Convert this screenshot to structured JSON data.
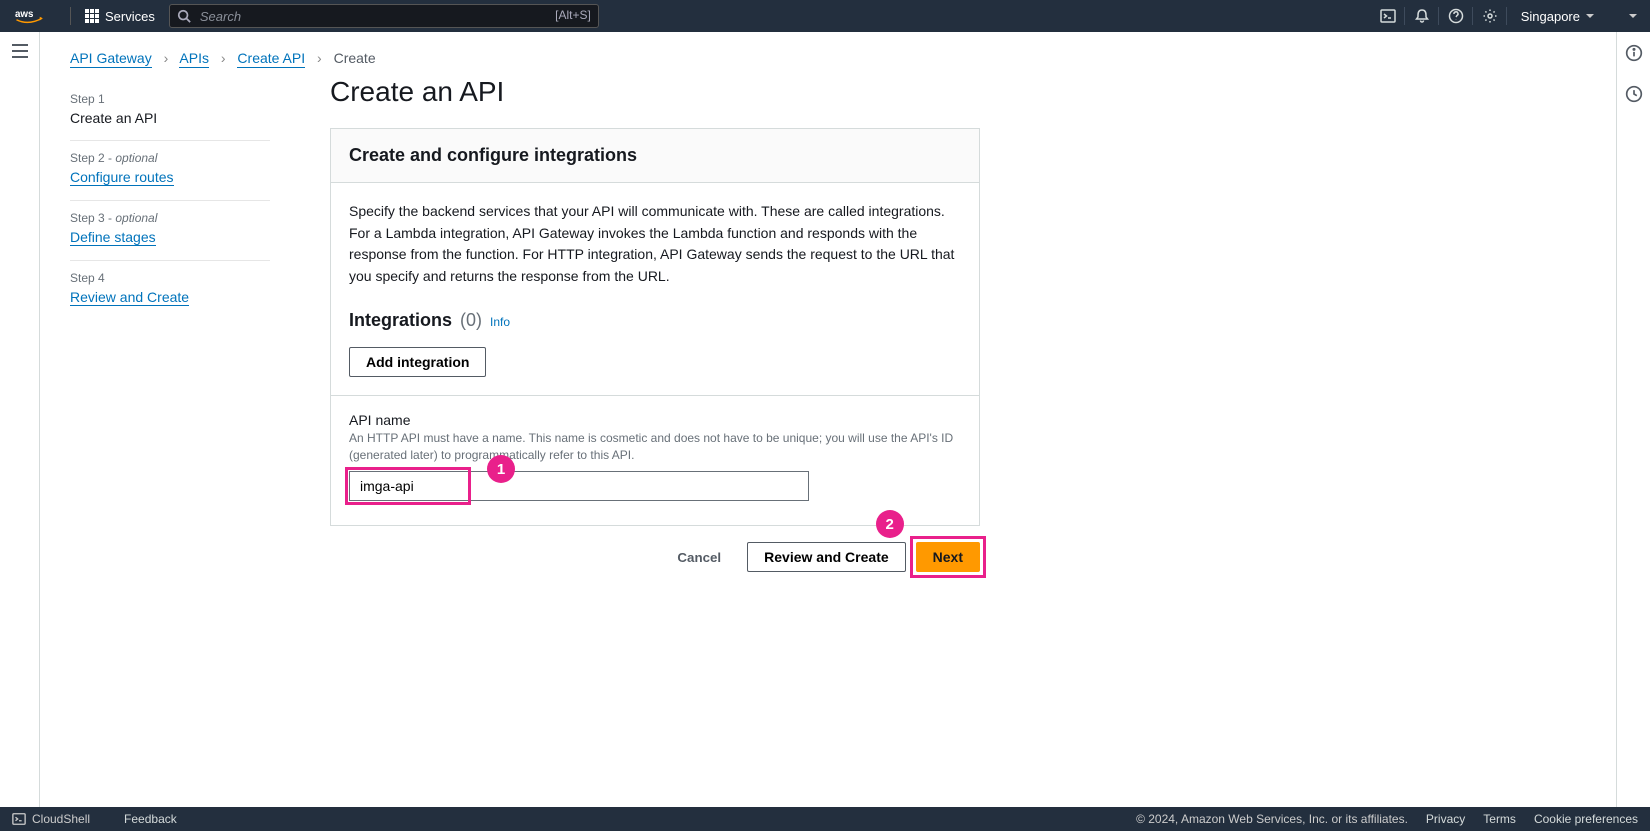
{
  "nav": {
    "services_label": "Services",
    "search_placeholder": "Search",
    "search_shortcut": "[Alt+S]",
    "region": "Singapore"
  },
  "breadcrumbs": {
    "items": [
      "API Gateway",
      "APIs",
      "Create API",
      "Create"
    ]
  },
  "steps": {
    "s1_hdr": "Step 1",
    "s1_label": "Create an API",
    "s2_hdr": "Step 2 - ",
    "s2_opt": "optional",
    "s2_label": "Configure routes",
    "s3_hdr": "Step 3 - ",
    "s3_opt": "optional",
    "s3_label": "Define stages",
    "s4_hdr": "Step 4",
    "s4_label": "Review and Create"
  },
  "page": {
    "title": "Create an API",
    "panel_title": "Create and configure integrations",
    "panel_desc": "Specify the backend services that your API will communicate with. These are called integrations. For a Lambda integration, API Gateway invokes the Lambda function and responds with the response from the function. For HTTP integration, API Gateway sends the request to the URL that you specify and returns the response from the URL.",
    "int_title": "Integrations",
    "int_count": "(0)",
    "info": "Info",
    "add_integration": "Add integration",
    "api_name_label": "API name",
    "api_name_hint": "An HTTP API must have a name. This name is cosmetic and does not have to be unique; you will use the API's ID (generated later) to programmatically refer to this API.",
    "api_name_value": "imga-api"
  },
  "actions": {
    "cancel": "Cancel",
    "review": "Review and Create",
    "next": "Next"
  },
  "annotations": {
    "one": "1",
    "two": "2"
  },
  "footer": {
    "cloudshell": "CloudShell",
    "feedback": "Feedback",
    "copyright": "© 2024, Amazon Web Services, Inc. or its affiliates.",
    "privacy": "Privacy",
    "terms": "Terms",
    "cookies": "Cookie preferences"
  }
}
